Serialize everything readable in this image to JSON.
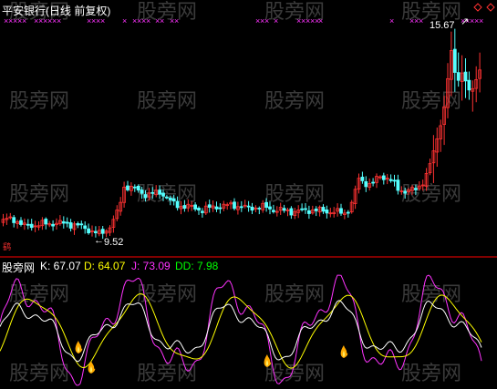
{
  "main_panel": {
    "title": "平安银行(日线 前复权)",
    "high_label": "15.67",
    "low_label": "9.52",
    "low_arrow": "←",
    "high_arrow": "↗",
    "corner_icon": "diamond-icon",
    "marker_glyph": "×",
    "marker_color": "#ff33ff",
    "up_color": "#ff3232",
    "down_color": "#54ffff"
  },
  "sub_panel": {
    "name": "股旁网",
    "k_label": "K: 67.07",
    "d_label": "D: 64.07",
    "j_label": "J: 73.09",
    "dd_label": "DD: 7.98",
    "k_color": "#ffffff",
    "d_color": "#ffff00",
    "j_color": "#ff33ff",
    "dd_color": "#00ff00",
    "signal_icon": "flame-icon"
  },
  "watermark": "股旁网",
  "chart_data": [
    {
      "type": "candlestick",
      "title": "平安银行(日线 前复权)",
      "annotations": [
        {
          "label": "9.52",
          "kind": "low"
        },
        {
          "label": "15.67",
          "kind": "high"
        }
      ],
      "ylim": [
        9.3,
        16.0
      ]
    },
    {
      "type": "line",
      "title": "股旁网",
      "series": [
        {
          "name": "K",
          "last": 67.07
        },
        {
          "name": "D",
          "last": 64.07
        },
        {
          "name": "J",
          "last": 73.09
        },
        {
          "name": "DD",
          "last": 7.98
        }
      ],
      "ylim": [
        -10,
        110
      ]
    }
  ]
}
